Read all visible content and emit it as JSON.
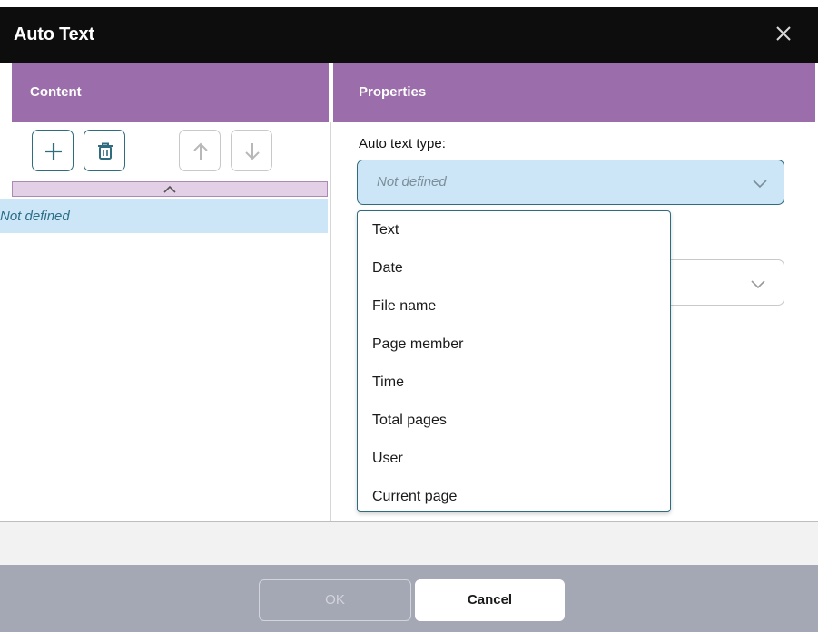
{
  "dialog": {
    "title": "Auto Text"
  },
  "content_panel": {
    "header": "Content",
    "selected_item": "Not defined"
  },
  "properties_panel": {
    "header": "Properties",
    "auto_text_type_label": "Auto text type:",
    "auto_text_type_value": "Not defined",
    "options": [
      "Text",
      "Date",
      "File name",
      "Page member",
      "Time",
      "Total pages",
      "User",
      "Current page"
    ]
  },
  "footer": {
    "ok_label": "OK",
    "cancel_label": "Cancel"
  },
  "icons": {
    "close": "close-icon",
    "add": "plus-icon",
    "delete": "trash-icon",
    "move_up": "arrow-up-icon",
    "move_down": "arrow-down-icon",
    "collapse": "chevron-up-icon",
    "dropdown": "chevron-down-icon"
  },
  "colors": {
    "titlebar": "#0d0d0d",
    "panel_header": "#9b6dab",
    "accent_border": "#2f6c7e",
    "selection": "#cce6f7",
    "footer": "#a4a8b4"
  }
}
